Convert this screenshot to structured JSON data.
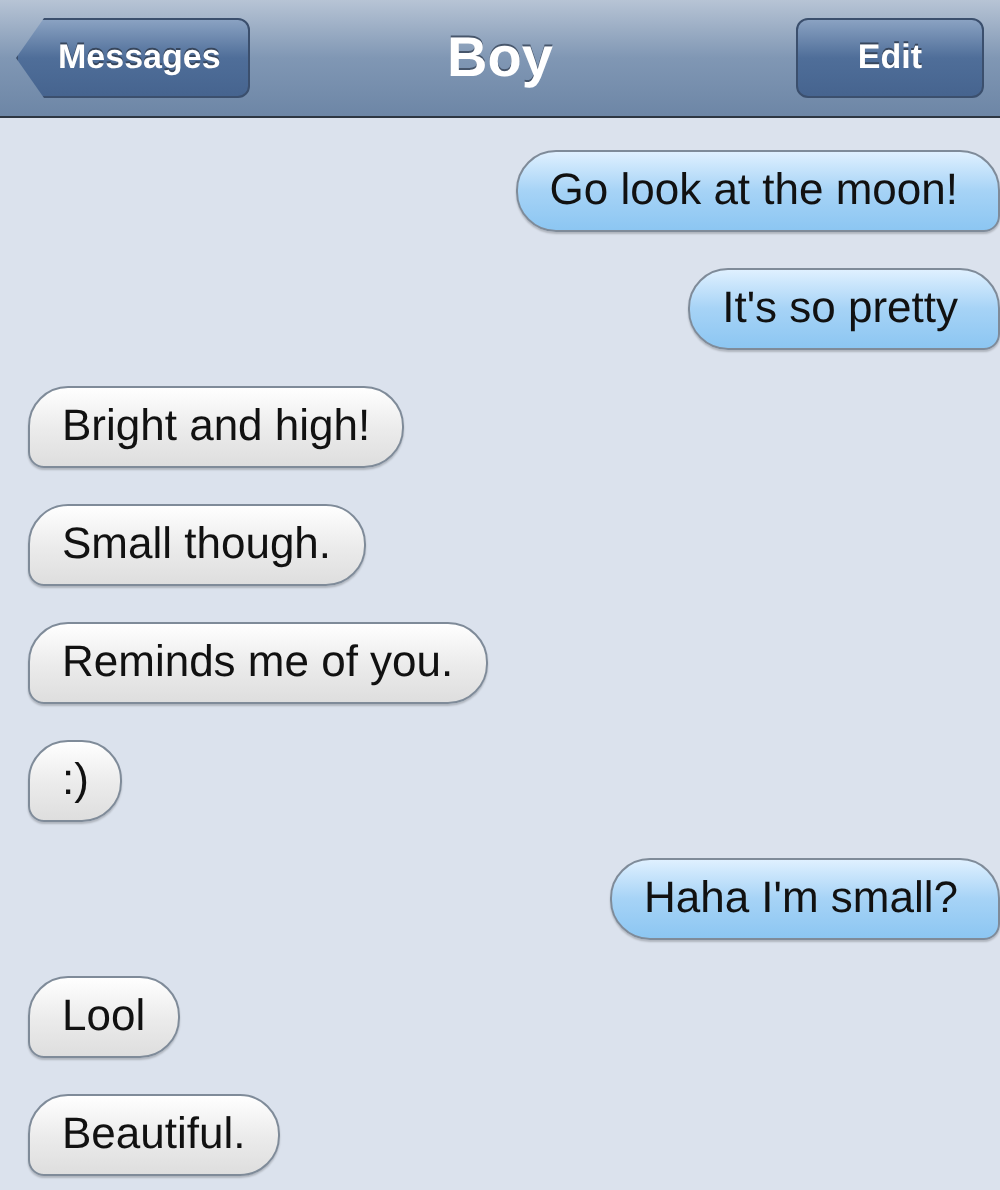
{
  "nav": {
    "back": "Messages",
    "title": "Boy",
    "edit": "Edit"
  },
  "messages": [
    {
      "kind": "sent",
      "text": "Go look at the moon!"
    },
    {
      "kind": "sent",
      "text": "It's so pretty"
    },
    {
      "kind": "received",
      "text": "Bright and high!"
    },
    {
      "kind": "received",
      "text": "Small though."
    },
    {
      "kind": "received",
      "text": "Reminds me of you."
    },
    {
      "kind": "received",
      "text": ":)"
    },
    {
      "kind": "sent",
      "text": "Haha I'm small?"
    },
    {
      "kind": "received",
      "text": "Lool"
    },
    {
      "kind": "received",
      "text": "Beautiful."
    }
  ]
}
